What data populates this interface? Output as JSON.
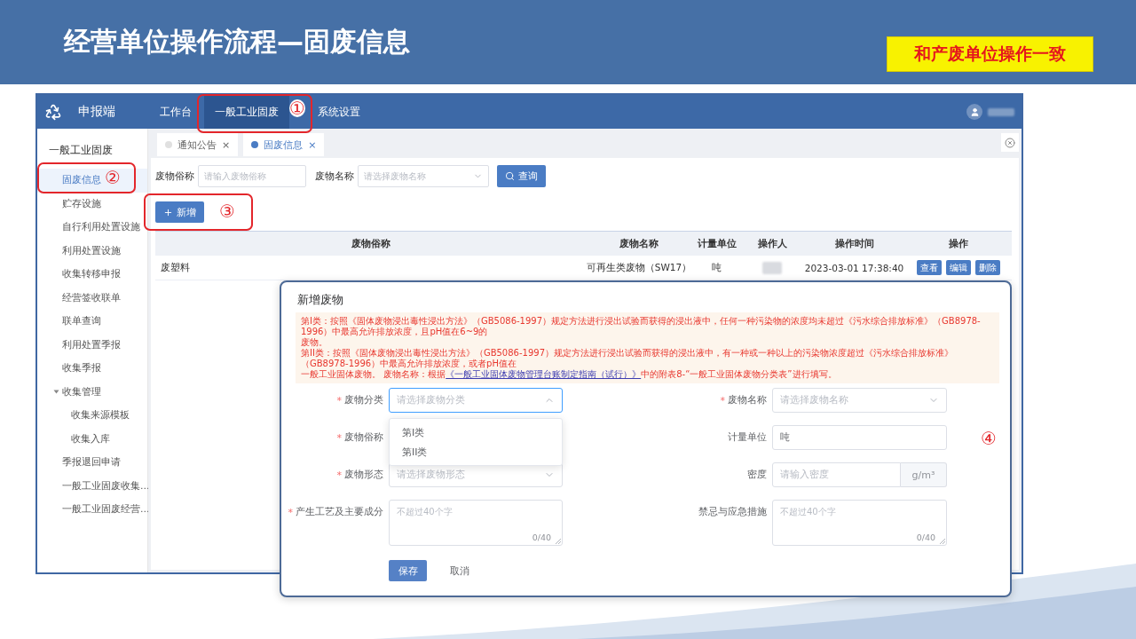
{
  "slide": {
    "title": "经营单位操作流程—固废信息",
    "badge": "和产废单位操作一致"
  },
  "app": {
    "brand": "申报端",
    "nav": [
      {
        "label": "工作台",
        "selected": false
      },
      {
        "label": "一般工业固废",
        "selected": true
      },
      {
        "label": "系统设置",
        "selected": false
      }
    ],
    "sidebar": {
      "heading": "一般工业固废",
      "items": [
        {
          "label": "固废信息",
          "selected": true
        },
        {
          "label": "贮存设施",
          "selected": false
        },
        {
          "label": "自行利用处置设施",
          "selected": false
        },
        {
          "label": "利用处置设施",
          "selected": false
        },
        {
          "label": "收集转移申报",
          "selected": false
        },
        {
          "label": "经营签收联单",
          "selected": false
        },
        {
          "label": "联单查询",
          "selected": false
        },
        {
          "label": "利用处置季报",
          "selected": false
        },
        {
          "label": "收集季报",
          "selected": false
        },
        {
          "label": "收集管理",
          "selected": false,
          "expanded": true,
          "children": [
            {
              "label": "收集来源模板",
              "selected": false
            },
            {
              "label": "收集入库",
              "selected": false
            }
          ]
        },
        {
          "label": "季报退回申请",
          "selected": false
        },
        {
          "label": "一般工业固废收集…",
          "selected": false
        },
        {
          "label": "一般工业固废经营…",
          "selected": false
        }
      ]
    },
    "tabs": [
      {
        "label": "通知公告",
        "close": "×",
        "selected": false
      },
      {
        "label": "固废信息",
        "close": "×",
        "selected": true
      }
    ],
    "filters": [
      {
        "label": "废物俗称",
        "kind": "input",
        "placeholder": "请输入废物俗称"
      },
      {
        "label": "废物名称",
        "kind": "select",
        "placeholder": "请选择废物名称"
      }
    ],
    "search_button": "查询",
    "add_button": "新增",
    "table": {
      "columns": [
        "废物俗称",
        "废物名称",
        "计量单位",
        "操作人",
        "操作时间",
        "操作"
      ],
      "rows": [
        {
          "cells": [
            {
              "kind": "text",
              "text": "废塑料"
            },
            {
              "kind": "text",
              "text": "可再生类废物（SW17）"
            },
            {
              "kind": "text",
              "text": "吨"
            },
            {
              "kind": "redacted"
            },
            {
              "kind": "text",
              "text": "2023-03-01 17:38:40"
            },
            {
              "kind": "actions",
              "buttons": [
                "查看",
                "编辑",
                "删除"
              ]
            }
          ]
        }
      ]
    }
  },
  "dialog": {
    "title": "新增废物",
    "notice": {
      "lines": [
        "第I类：按照《固体废物浸出毒性浸出方法》（GB5086-1997）规定方法进行浸出试验而获得的浸出液中，任何一种污染物的浓度均未超过《污水综合排放标准》（GB8978-1996）中最高允许排放浓度，且pH值在6~9的",
        "废物。",
        "第II类：按照《固体废物浸出毒性浸出方法》（GB5086-1997）规定方法进行浸出试验而获得的浸出液中，有一种或一种以上的污染物浓度超过《污水综合排放标准》（GB8978-1996）中最高允许排放浓度，或者pH值在"
      ],
      "last_line": {
        "before": "一般工业固体废物。 废物名称：根据",
        "link": "《一般工业固体废物管理台账制定指南（试行）》",
        "after": "中的附表8-“一般工业固体废物分类表”进行填写。"
      }
    },
    "fields": [
      {
        "label": "废物分类",
        "required_mark": "*",
        "kind": "select",
        "placeholder": "请选择废物分类",
        "expanded": true,
        "options": [
          {
            "label": "第I类",
            "selected": false
          },
          {
            "label": "第II类",
            "selected": false
          }
        ]
      },
      {
        "label": "废物名称",
        "required_mark": "*",
        "kind": "select",
        "placeholder": "请选择废物名称",
        "expanded": false
      },
      {
        "label": "废物俗称",
        "required_mark": "*",
        "kind": "covered"
      },
      {
        "label": "计量单位",
        "kind": "input",
        "value": "吨"
      },
      {
        "label": "废物形态",
        "required_mark": "*",
        "kind": "select",
        "placeholder": "请选择废物形态",
        "expanded": false
      },
      {
        "label": "密度",
        "kind": "input_unit",
        "placeholder": "请输入密度",
        "unit": "g/m³"
      },
      {
        "label": "产生工艺及主要成分",
        "required_mark": "*",
        "kind": "textarea",
        "placeholder": "不超过40个字",
        "counter": "0/40"
      },
      {
        "label": "禁忌与应急措施",
        "kind": "textarea",
        "placeholder": "不超过40个字",
        "counter": "0/40"
      }
    ],
    "buttons": [
      {
        "label": "保存",
        "kind": "primary"
      },
      {
        "label": "取消",
        "kind": "text"
      }
    ]
  },
  "annotations": [
    {
      "number": "①",
      "outlined": true
    },
    {
      "number": "②",
      "outlined": true
    },
    {
      "number": "③",
      "outlined": true
    },
    {
      "number": "④",
      "outlined": false
    }
  ]
}
